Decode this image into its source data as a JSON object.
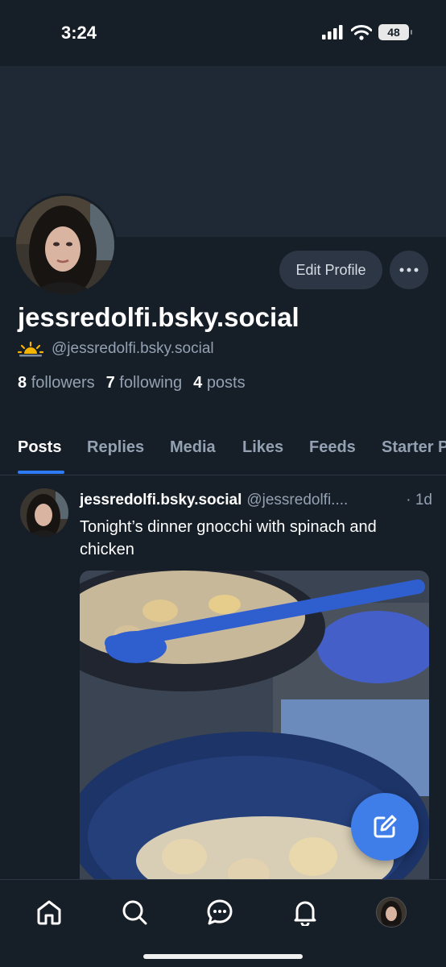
{
  "status_bar": {
    "time": "3:24",
    "battery": "48"
  },
  "profile": {
    "display_name": "jessredolfi.bsky.social",
    "handle": "@jessredolfi.bsky.social",
    "edit_label": "Edit Profile",
    "followers_count": "8",
    "followers_label": "followers",
    "following_count": "7",
    "following_label": "following",
    "posts_count": "4",
    "posts_label": "posts"
  },
  "tabs": [
    {
      "label": "Posts",
      "active": true
    },
    {
      "label": "Replies"
    },
    {
      "label": "Media"
    },
    {
      "label": "Likes"
    },
    {
      "label": "Feeds"
    },
    {
      "label": "Starter Packs"
    }
  ],
  "post": {
    "author": "jessredolfi.bsky.social",
    "handle": "@jessredolfi....",
    "time": "· 1d",
    "text": "Tonight’s dinner gnocchi with spinach and chicken"
  },
  "icons": {
    "nav": [
      "home-icon",
      "search-icon",
      "chat-icon",
      "bell-icon",
      "profile-avatar"
    ],
    "fab": "compose-icon"
  },
  "colors": {
    "background": "#161e27",
    "banner": "#1f2936",
    "accent": "#2d7bf7",
    "fab": "#3f7de8",
    "muted": "#93a1b2"
  }
}
